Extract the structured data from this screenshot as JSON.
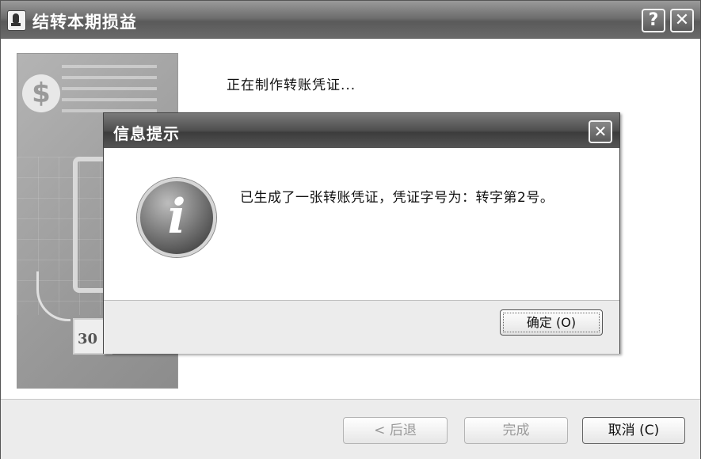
{
  "window": {
    "title": "结转本期损益",
    "help_label": "?",
    "close_label": "✕"
  },
  "sidepanel": {
    "coin_symbol": "$",
    "calendar_number": "30"
  },
  "main": {
    "progress_text": "正在制作转账凭证..."
  },
  "wizard_buttons": {
    "back_label": "< 后退",
    "finish_label": "完成",
    "cancel_label": "取消 (C)"
  },
  "dialog": {
    "title": "信息提示",
    "close_label": "✕",
    "icon_glyph": "i",
    "message": "已生成了一张转账凭证，凭证字号为：转字第2号。",
    "ok_label": "确定 (O)"
  }
}
